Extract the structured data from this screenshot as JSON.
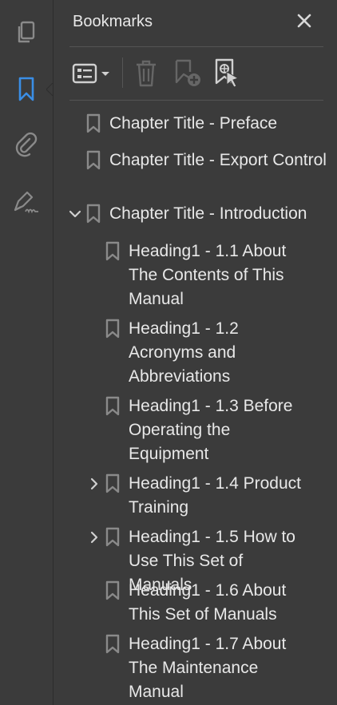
{
  "panel": {
    "title": "Bookmarks"
  },
  "rail": {
    "items": [
      {
        "icon": "pages-icon"
      },
      {
        "icon": "bookmark-icon",
        "active": true
      },
      {
        "icon": "attachment-icon"
      },
      {
        "icon": "signature-icon"
      }
    ]
  },
  "toolbar": {
    "buttons": [
      {
        "icon": "options-menu-icon"
      },
      {
        "icon": "trash-icon"
      },
      {
        "icon": "add-bookmark-icon"
      },
      {
        "icon": "bookmark-select-icon"
      }
    ]
  },
  "colors": {
    "accent": "#3a8ee6",
    "background": "#3b3b3b",
    "icon": "#8a8a8a",
    "text": "#e8e8e8"
  },
  "bookmarks": [
    {
      "label": "Chapter Title - Preface",
      "level": 0,
      "expander": "none"
    },
    {
      "label": "Chapter Title - Export Control",
      "level": 0,
      "expander": "none"
    },
    {
      "label": "Chapter Title - Introduction",
      "level": 0,
      "expander": "expanded"
    },
    {
      "label": "Heading1 - 1.1 About The Contents of This Manual",
      "level": 1,
      "expander": "none"
    },
    {
      "label": "Heading1 - 1.2 Acronyms and Abbreviations",
      "level": 1,
      "expander": "none"
    },
    {
      "label": "Heading1 - 1.3 Before Operating the Equipment",
      "level": 1,
      "expander": "none"
    },
    {
      "label": "Heading1 - 1.4 Product Training",
      "level": 1,
      "expander": "collapsed"
    },
    {
      "label": "Heading1 - 1.5 How to Use This Set of Manuals",
      "level": 1,
      "expander": "collapsed"
    },
    {
      "label": "Heading1 - 1.6 About This Set of Manuals",
      "level": 1,
      "expander": "none"
    },
    {
      "label": "Heading1 - 1.7 About The Maintenance Manual",
      "level": 1,
      "expander": "none"
    }
  ]
}
